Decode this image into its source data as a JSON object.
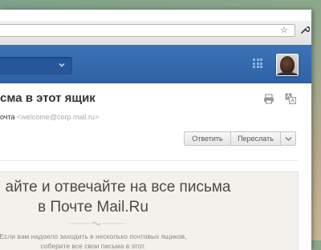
{
  "mail": {
    "subject": "сма в этот ящик",
    "from_label": "очта",
    "from_email": "<welcome@corp.mail.ru>",
    "buttons": {
      "reply": "Ответить",
      "forward": "Переслать"
    }
  },
  "promo": {
    "line1": "айте и отвечайте на все письма",
    "line2": "в Почте Mail.Ru",
    "text1": "Если вам надоело заходить в несколько почтовых ящиков,",
    "text2": "соберите все свои письма в этот."
  },
  "colors": {
    "header_blue": "#3b72b6",
    "header_select": "#27569a"
  },
  "icons": [
    "star-icon",
    "wrench-icon",
    "chevron-down-icon",
    "apps-grid-icon",
    "print-icon",
    "translate-icon"
  ]
}
